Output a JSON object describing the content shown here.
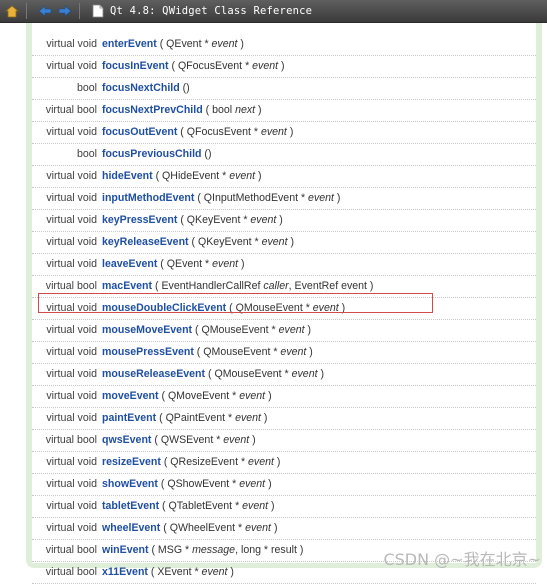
{
  "window": {
    "title": "Qt 4.8: QWidget Class Reference"
  },
  "toolbar_icons": [
    "home-icon",
    "back-icon",
    "forward-icon",
    "document-icon"
  ],
  "members": [
    {
      "type": "virtual void",
      "name": "enterEvent",
      "pre": " ( QEvent * ",
      "arg": "event",
      "post": " )"
    },
    {
      "type": "virtual void",
      "name": "focusInEvent",
      "pre": " ( QFocusEvent * ",
      "arg": "event",
      "post": " )"
    },
    {
      "type": "bool",
      "name": "focusNextChild",
      "pre": " ()",
      "arg": "",
      "post": ""
    },
    {
      "type": "virtual bool",
      "name": "focusNextPrevChild",
      "pre": " ( bool ",
      "arg": "next",
      "post": " )"
    },
    {
      "type": "virtual void",
      "name": "focusOutEvent",
      "pre": " ( QFocusEvent * ",
      "arg": "event",
      "post": " )"
    },
    {
      "type": "bool",
      "name": "focusPreviousChild",
      "pre": " ()",
      "arg": "",
      "post": ""
    },
    {
      "type": "virtual void",
      "name": "hideEvent",
      "pre": " ( QHideEvent * ",
      "arg": "event",
      "post": " )"
    },
    {
      "type": "virtual void",
      "name": "inputMethodEvent",
      "pre": " ( QInputMethodEvent * ",
      "arg": "event",
      "post": " )"
    },
    {
      "type": "virtual void",
      "name": "keyPressEvent",
      "pre": " ( QKeyEvent * ",
      "arg": "event",
      "post": " )"
    },
    {
      "type": "virtual void",
      "name": "keyReleaseEvent",
      "pre": " ( QKeyEvent * ",
      "arg": "event",
      "post": " )"
    },
    {
      "type": "virtual void",
      "name": "leaveEvent",
      "pre": " ( QEvent * ",
      "arg": "event",
      "post": " )"
    },
    {
      "type": "virtual bool",
      "name": "macEvent",
      "pre": " ( EventHandlerCallRef ",
      "arg": "caller",
      "post": ", EventRef event )"
    },
    {
      "type": "virtual void",
      "name": "mouseDoubleClickEvent",
      "pre": " ( QMouseEvent * ",
      "arg": "event",
      "post": " )"
    },
    {
      "type": "virtual void",
      "name": "mouseMoveEvent",
      "pre": " ( QMouseEvent * ",
      "arg": "event",
      "post": " )"
    },
    {
      "type": "virtual void",
      "name": "mousePressEvent",
      "pre": " ( QMouseEvent * ",
      "arg": "event",
      "post": " )"
    },
    {
      "type": "virtual void",
      "name": "mouseReleaseEvent",
      "pre": " ( QMouseEvent * ",
      "arg": "event",
      "post": " )"
    },
    {
      "type": "virtual void",
      "name": "moveEvent",
      "pre": " ( QMoveEvent * ",
      "arg": "event",
      "post": " )"
    },
    {
      "type": "virtual void",
      "name": "paintEvent",
      "pre": " ( QPaintEvent * ",
      "arg": "event",
      "post": " )"
    },
    {
      "type": "virtual bool",
      "name": "qwsEvent",
      "pre": " ( QWSEvent * ",
      "arg": "event",
      "post": " )"
    },
    {
      "type": "virtual void",
      "name": "resizeEvent",
      "pre": " ( QResizeEvent * ",
      "arg": "event",
      "post": " )"
    },
    {
      "type": "virtual void",
      "name": "showEvent",
      "pre": " ( QShowEvent * ",
      "arg": "event",
      "post": " )"
    },
    {
      "type": "virtual void",
      "name": "tabletEvent",
      "pre": " ( QTabletEvent * ",
      "arg": "event",
      "post": " )"
    },
    {
      "type": "virtual void",
      "name": "wheelEvent",
      "pre": " ( QWheelEvent * ",
      "arg": "event",
      "post": " )"
    },
    {
      "type": "virtual bool",
      "name": "winEvent",
      "pre": " ( MSG * ",
      "arg": "message",
      "post": ", long * result )"
    },
    {
      "type": "virtual bool",
      "name": "x11Event",
      "pre": " ( XEvent * ",
      "arg": "event",
      "post": " )"
    }
  ],
  "highlighted_member": "mouseDoubleClickEvent",
  "watermark": "CSDN @~我在北京~",
  "colors": {
    "link": "#1f4fa3",
    "highlight_border": "#d24b4b",
    "sidebar_green": "#dfeed9"
  }
}
